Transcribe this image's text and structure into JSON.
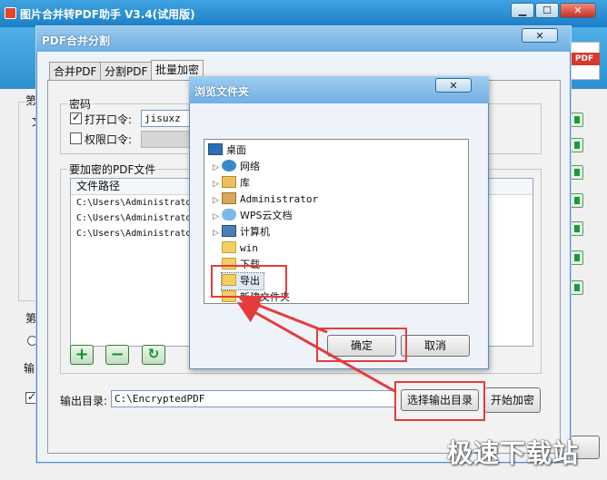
{
  "main_window": {
    "title": "图片合并转PDF助手 V3.4(试用版)",
    "minimize_label": "▁",
    "maximize_label": "☐",
    "close_label": "✕",
    "pdf_badge": "PDF",
    "partial_left_group_1": "第",
    "partial_left_text_1": "文",
    "partial_left_group_2": "第",
    "partial_left_text_2": "输",
    "partial_right_text": "片"
  },
  "dialog": {
    "title": "PDF合并分割",
    "close_label": "✕",
    "tabs": [
      {
        "label": "合并PDF",
        "active": false
      },
      {
        "label": "分割PDF",
        "active": false
      },
      {
        "label": "批量加密",
        "active": true
      }
    ],
    "password_group_label": "密码",
    "open_password_label": "打开口令:",
    "open_password_checked": true,
    "open_password_value": "jisuxz",
    "permission_password_label": "权限口令:",
    "permission_password_checked": false,
    "files_group_label": "要加密的PDF文件",
    "table": {
      "column_header": "文件路径",
      "rows": [
        "C:\\Users\\Administrato",
        "C:\\Users\\Administrato",
        "C:\\Users\\Administrato"
      ]
    },
    "add_label": "+",
    "remove_label": "−",
    "refresh_label": "↻",
    "output_dir_label": "输出目录:",
    "output_dir_value": "C:\\EncryptedPDF",
    "choose_output_button": "选择输出目录",
    "start_encrypt_button": "开始加密"
  },
  "browse_dialog": {
    "title": "浏览文件夹",
    "close_label": "✕",
    "tree": [
      {
        "label": "桌面",
        "icon": "desktop-icon",
        "indent": 0,
        "expandable": false
      },
      {
        "label": "网络",
        "icon": "network-icon",
        "indent": 1,
        "expandable": true
      },
      {
        "label": "库",
        "icon": "library-icon",
        "indent": 1,
        "expandable": true
      },
      {
        "label": "Administrator",
        "icon": "user-folder-icon",
        "indent": 1,
        "expandable": true
      },
      {
        "label": "WPS云文档",
        "icon": "cloud-icon",
        "indent": 1,
        "expandable": true
      },
      {
        "label": "计算机",
        "icon": "computer-icon",
        "indent": 1,
        "expandable": true
      },
      {
        "label": "win",
        "icon": "folder-icon",
        "indent": 1,
        "expandable": false
      },
      {
        "label": "下载",
        "icon": "folder-icon",
        "indent": 1,
        "expandable": false
      },
      {
        "label": "导出",
        "icon": "folder-icon",
        "indent": 1,
        "expandable": false,
        "selected": true
      },
      {
        "label": "新建文件夹",
        "icon": "folder-icon",
        "indent": 1,
        "expandable": false
      }
    ],
    "ok_button": "确定",
    "cancel_button": "取消"
  },
  "watermark": "极速下载站",
  "colors": {
    "annotation_red": "#e53b3b",
    "titlebar_blue": "#3fa3e2",
    "add_green": "#17902e"
  }
}
